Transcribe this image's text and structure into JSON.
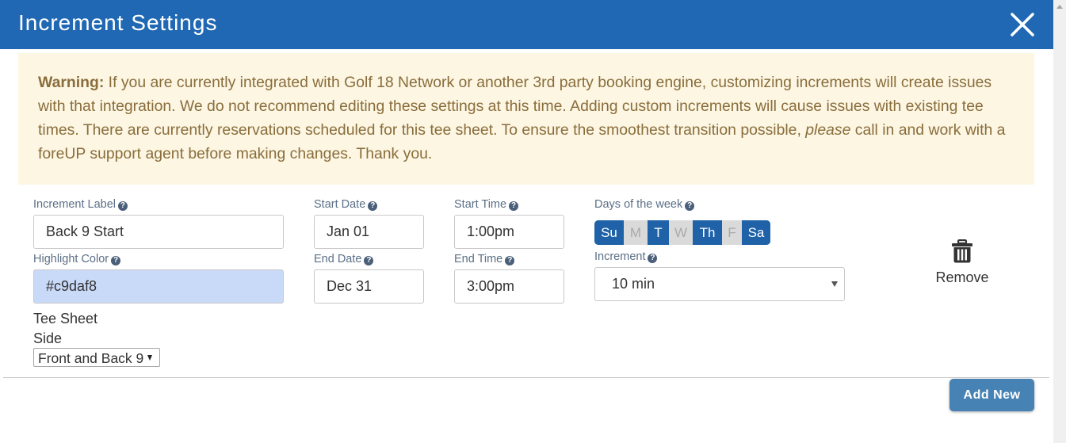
{
  "modal": {
    "title": "Increment Settings",
    "close_icon": "close-x-icon"
  },
  "warning": {
    "label": "Warning:",
    "text_1": " If you are currently integrated with Golf 18 Network or another 3rd party booking engine, customizing increments will create issues with that integration. We do not recommend editing these settings at this time. Adding custom increments will cause issues with existing tee times. There are currently reservations scheduled for this tee sheet. To ensure the smoothest transition possible, ",
    "emphasis": "please",
    "text_2": " call in and work with a foreUP support agent before making changes. Thank you."
  },
  "form": {
    "increment_label": {
      "label": "Increment Label",
      "value": "Back 9 Start"
    },
    "highlight_color": {
      "label": "Highlight Color",
      "value": "#c9daf8",
      "swatch": "#c9daf8"
    },
    "start_date": {
      "label": "Start Date",
      "value": "Jan 01"
    },
    "end_date": {
      "label": "End Date",
      "value": "Dec 31"
    },
    "start_time": {
      "label": "Start Time",
      "value": "1:00pm"
    },
    "end_time": {
      "label": "End Time",
      "value": "3:00pm"
    },
    "days_of_week": {
      "label": "Days of the week",
      "days": [
        {
          "label": "Su",
          "selected": true
        },
        {
          "label": "M",
          "selected": false
        },
        {
          "label": "T",
          "selected": true
        },
        {
          "label": "W",
          "selected": false
        },
        {
          "label": "Th",
          "selected": true
        },
        {
          "label": "F",
          "selected": false
        },
        {
          "label": "Sa",
          "selected": true
        }
      ]
    },
    "increment": {
      "label": "Increment",
      "value": "10 min"
    },
    "tee_sheet_side": {
      "label_line1": "Tee Sheet",
      "label_line2": "Side",
      "value": "Front and Back 9"
    },
    "help_icon": "?",
    "remove_label": "Remove"
  },
  "footer": {
    "add_new_label": "Add New"
  },
  "colors": {
    "header": "#2068b3",
    "warning_bg": "#fcf6e3",
    "warning_text": "#8a6d3b",
    "day_selected": "#1f62a8",
    "day_unselected": "#dadada",
    "add_button": "#4682b4"
  }
}
